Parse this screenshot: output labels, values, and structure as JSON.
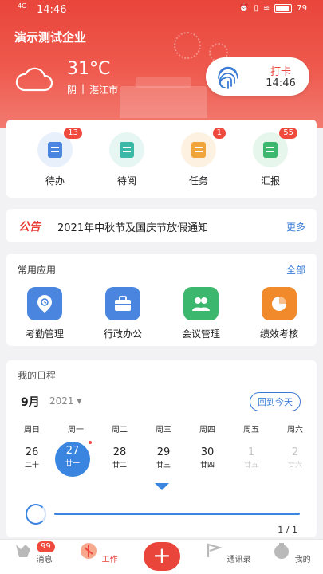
{
  "status": {
    "time": "14:46",
    "signal": "4G",
    "battery": "79"
  },
  "header": {
    "company": "演示测试企业",
    "temperature": "31°C",
    "weather": "阴",
    "city": "湛江市"
  },
  "clock_in": {
    "label": "打卡",
    "time": "14:46"
  },
  "quick": [
    {
      "label": "待办",
      "badge": "13",
      "color": "#4a86e0",
      "icon": "todo-icon"
    },
    {
      "label": "待阅",
      "badge": "",
      "color": "#3cb8a6",
      "icon": "read-icon"
    },
    {
      "label": "任务",
      "badge": "1",
      "color": "#f0a53a",
      "icon": "task-icon"
    },
    {
      "label": "汇报",
      "badge": "55",
      "color": "#3cb86e",
      "icon": "report-icon"
    }
  ],
  "notice": {
    "tag": "公告",
    "text": "2021年中秋节及国庆节放假通知",
    "more": "更多"
  },
  "apps": {
    "title": "常用应用",
    "all": "全部",
    "items": [
      {
        "label": "考勤管理",
        "color": "#4a86e0",
        "icon": "attendance-icon"
      },
      {
        "label": "行政办公",
        "color": "#4a86e0",
        "icon": "briefcase-icon"
      },
      {
        "label": "会议管理",
        "color": "#3cb86e",
        "icon": "meeting-icon"
      },
      {
        "label": "绩效考核",
        "color": "#f08a2a",
        "icon": "pie-chart-icon"
      }
    ]
  },
  "schedule": {
    "title": "我的日程",
    "month": "9月",
    "year": "2021",
    "today_btn": "回到今天",
    "weekdays": [
      "周日",
      "周一",
      "周二",
      "周三",
      "周四",
      "周五",
      "周六"
    ],
    "days": [
      {
        "n": "26",
        "l": "二十",
        "state": "normal"
      },
      {
        "n": "27",
        "l": "廿一",
        "state": "selected"
      },
      {
        "n": "28",
        "l": "廿二",
        "state": "normal"
      },
      {
        "n": "29",
        "l": "廿三",
        "state": "normal"
      },
      {
        "n": "30",
        "l": "廿四",
        "state": "normal"
      },
      {
        "n": "1",
        "l": "廿五",
        "state": "dim"
      },
      {
        "n": "2",
        "l": "廿六",
        "state": "dim"
      }
    ],
    "pager": "1 / 1"
  },
  "tabbar": {
    "items": [
      {
        "label": "消息",
        "badge": "99"
      },
      {
        "label": "工作",
        "badge": ""
      },
      {
        "label": "通讯录",
        "badge": ""
      },
      {
        "label": "我的",
        "badge": ""
      }
    ],
    "add": "+"
  }
}
